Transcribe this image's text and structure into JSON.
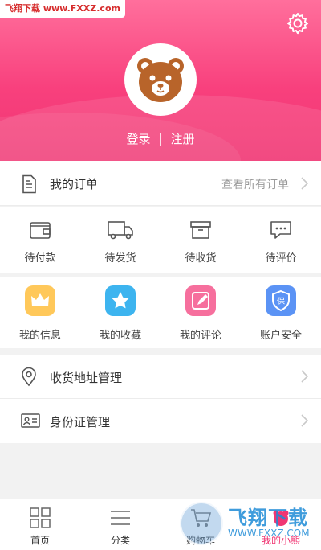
{
  "watermark_top": "飞翔下载 www.FXXZ.com",
  "header": {
    "login": "登录",
    "register": "注册"
  },
  "orders": {
    "title": "我的订单",
    "view_all": "查看所有订单",
    "items": [
      {
        "label": "待付款",
        "icon": "wallet-icon"
      },
      {
        "label": "待发货",
        "icon": "truck-icon"
      },
      {
        "label": "待收货",
        "icon": "box-icon"
      },
      {
        "label": "待评价",
        "icon": "comment-icon"
      }
    ]
  },
  "services": [
    {
      "label": "我的信息",
      "icon": "crown-icon",
      "color": "#ffc85a"
    },
    {
      "label": "我的收藏",
      "icon": "star-icon",
      "color": "#3db4ef"
    },
    {
      "label": "我的评论",
      "icon": "edit-icon",
      "color": "#f66f9d"
    },
    {
      "label": "账户安全",
      "icon": "shield-icon",
      "color": "#5b93f5",
      "badge_text": "保"
    }
  ],
  "list": [
    {
      "label": "收货地址管理",
      "icon": "location-pin-icon"
    },
    {
      "label": "身份证管理",
      "icon": "id-card-icon"
    }
  ],
  "tabs": [
    {
      "label": "首页",
      "icon": "grid-icon"
    },
    {
      "label": "分类",
      "icon": "menu-lines-icon"
    },
    {
      "label": "购物车",
      "icon": "cart-icon"
    },
    {
      "label": "我的小熊",
      "icon": "bear-icon",
      "active": true
    }
  ],
  "watermark_bottom": {
    "brand": "飞翔下载",
    "url": "WWW.FXXZ.COM"
  },
  "colors": {
    "accent": "#f03673",
    "header_top": "#ff6f9c"
  }
}
